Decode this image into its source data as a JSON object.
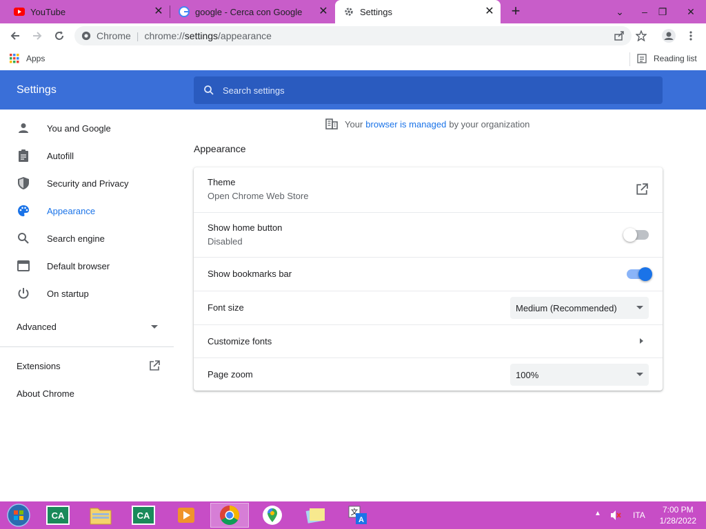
{
  "tabs": [
    {
      "title": "YouTube",
      "icon": "youtube-icon"
    },
    {
      "title": "google - Cerca con Google",
      "icon": "google-icon"
    },
    {
      "title": "Settings",
      "icon": "gear-icon"
    }
  ],
  "omnibox": {
    "origin": "Chrome",
    "url_scheme": "chrome://",
    "url_host": "settings",
    "url_path": "/appearance"
  },
  "bookmarks": {
    "apps": "Apps",
    "reading_list": "Reading list"
  },
  "settings": {
    "title": "Settings",
    "search_placeholder": "Search settings",
    "nav": [
      {
        "label": "You and Google",
        "icon": "person-icon"
      },
      {
        "label": "Autofill",
        "icon": "clipboard-icon"
      },
      {
        "label": "Security and Privacy",
        "icon": "shield-icon"
      },
      {
        "label": "Appearance",
        "icon": "palette-icon",
        "selected": true
      },
      {
        "label": "Search engine",
        "icon": "search-icon"
      },
      {
        "label": "Default browser",
        "icon": "browser-icon"
      },
      {
        "label": "On startup",
        "icon": "power-icon"
      }
    ],
    "advanced": "Advanced",
    "extensions": "Extensions",
    "about": "About Chrome",
    "managed": {
      "prefix": "Your",
      "link": "browser is managed",
      "suffix": "by your organization"
    },
    "section_title": "Appearance",
    "rows": {
      "theme": {
        "label": "Theme",
        "sub": "Open Chrome Web Store"
      },
      "home": {
        "label": "Show home button",
        "sub": "Disabled",
        "enabled": false
      },
      "bookmarks_bar": {
        "label": "Show bookmarks bar",
        "enabled": true
      },
      "font_size": {
        "label": "Font size",
        "value": "Medium (Recommended)"
      },
      "customize_fonts": {
        "label": "Customize fonts"
      },
      "page_zoom": {
        "label": "Page zoom",
        "value": "100%"
      }
    }
  },
  "taskbar": {
    "lang": "ITA",
    "time": "7:00 PM",
    "date": "1/28/2022"
  },
  "colors": {
    "accent": "#1a73e8",
    "header": "#3a6fd8",
    "tabstrip": "#c85dc9",
    "taskbar": "#c74dc6"
  }
}
